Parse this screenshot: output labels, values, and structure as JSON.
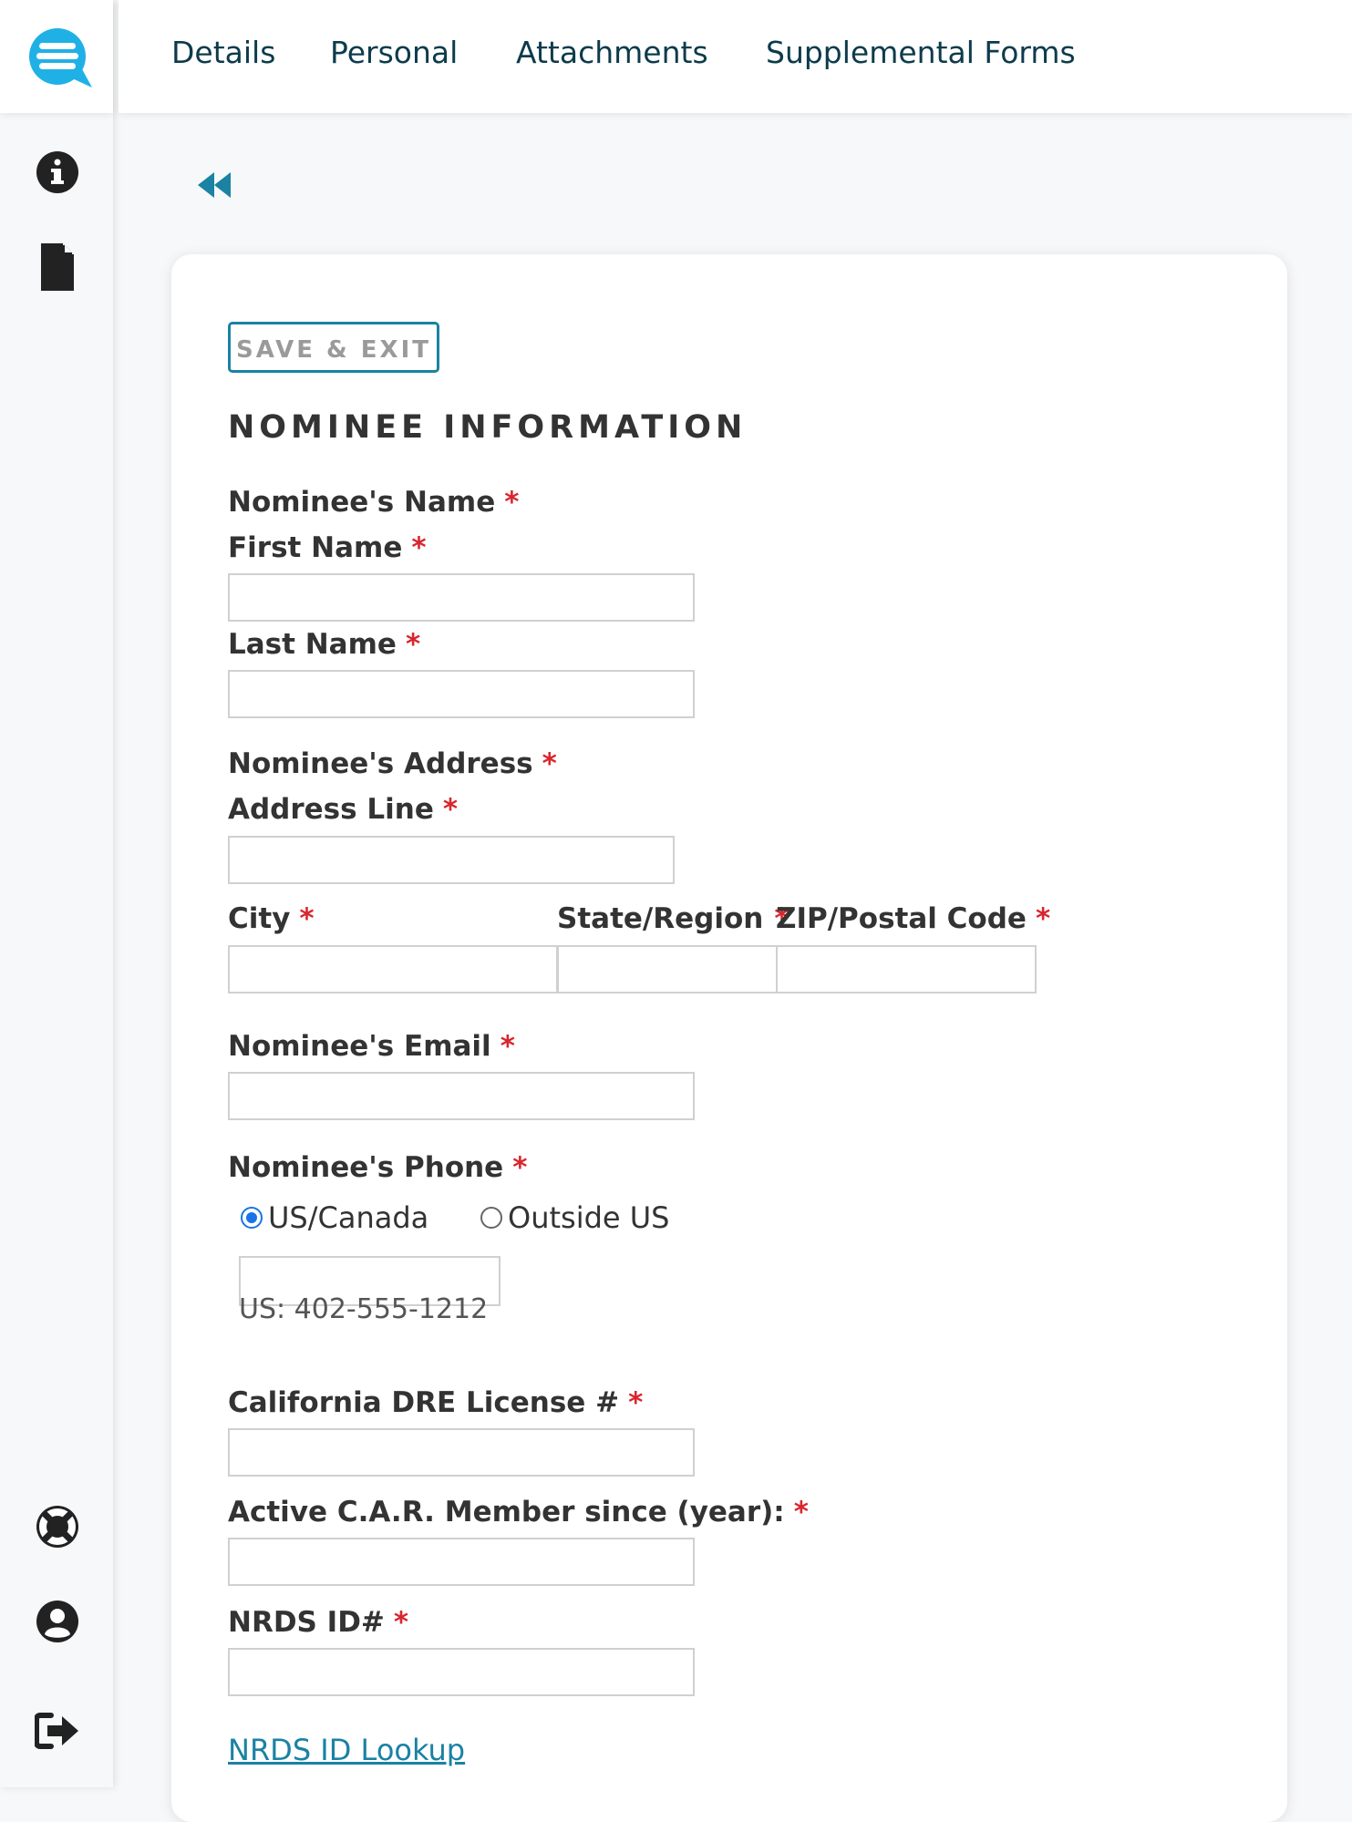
{
  "nav": {
    "tabs": [
      "Details",
      "Personal",
      "Attachments",
      "Supplemental Forms"
    ]
  },
  "sidebar": {
    "icons": [
      "chat-logo-icon",
      "info-icon",
      "document-icon",
      "lifebuoy-icon",
      "user-icon",
      "sign-out-icon"
    ]
  },
  "form": {
    "save_exit_label": "SAVE & EXIT",
    "section_title": "NOMINEE INFORMATION",
    "required_mark": "*",
    "nominee_name_label": "Nominee's Name",
    "first_name_label": "First Name",
    "first_name_value": "",
    "last_name_label": "Last Name",
    "last_name_value": "",
    "nominee_address_label": "Nominee's Address",
    "address_line_label": "Address Line",
    "address_line_value": "",
    "city_label": "City",
    "city_value": "",
    "state_label": "State/Region",
    "state_value": "",
    "zip_label": "ZIP/Postal Code",
    "zip_value": "",
    "email_label": "Nominee's Email",
    "email_value": "",
    "phone_label": "Nominee's Phone",
    "phone_option_us": "US/Canada",
    "phone_option_outside": "Outside US",
    "phone_selected": "US/Canada",
    "phone_value": "",
    "phone_hint": "US: 402-555-1212",
    "dre_label": "California DRE License #",
    "dre_value": "",
    "car_label": "Active C.A.R. Member since (year):",
    "car_value": "",
    "nrds_label": "NRDS ID#",
    "nrds_value": "",
    "nrds_lookup_link": "NRDS ID Lookup"
  },
  "colors": {
    "accent": "#1a82a3",
    "logo": "#1fb1e6",
    "nav_text": "#0d3b4c",
    "required": "#d9262e",
    "radio_selected": "#1a73e8"
  }
}
